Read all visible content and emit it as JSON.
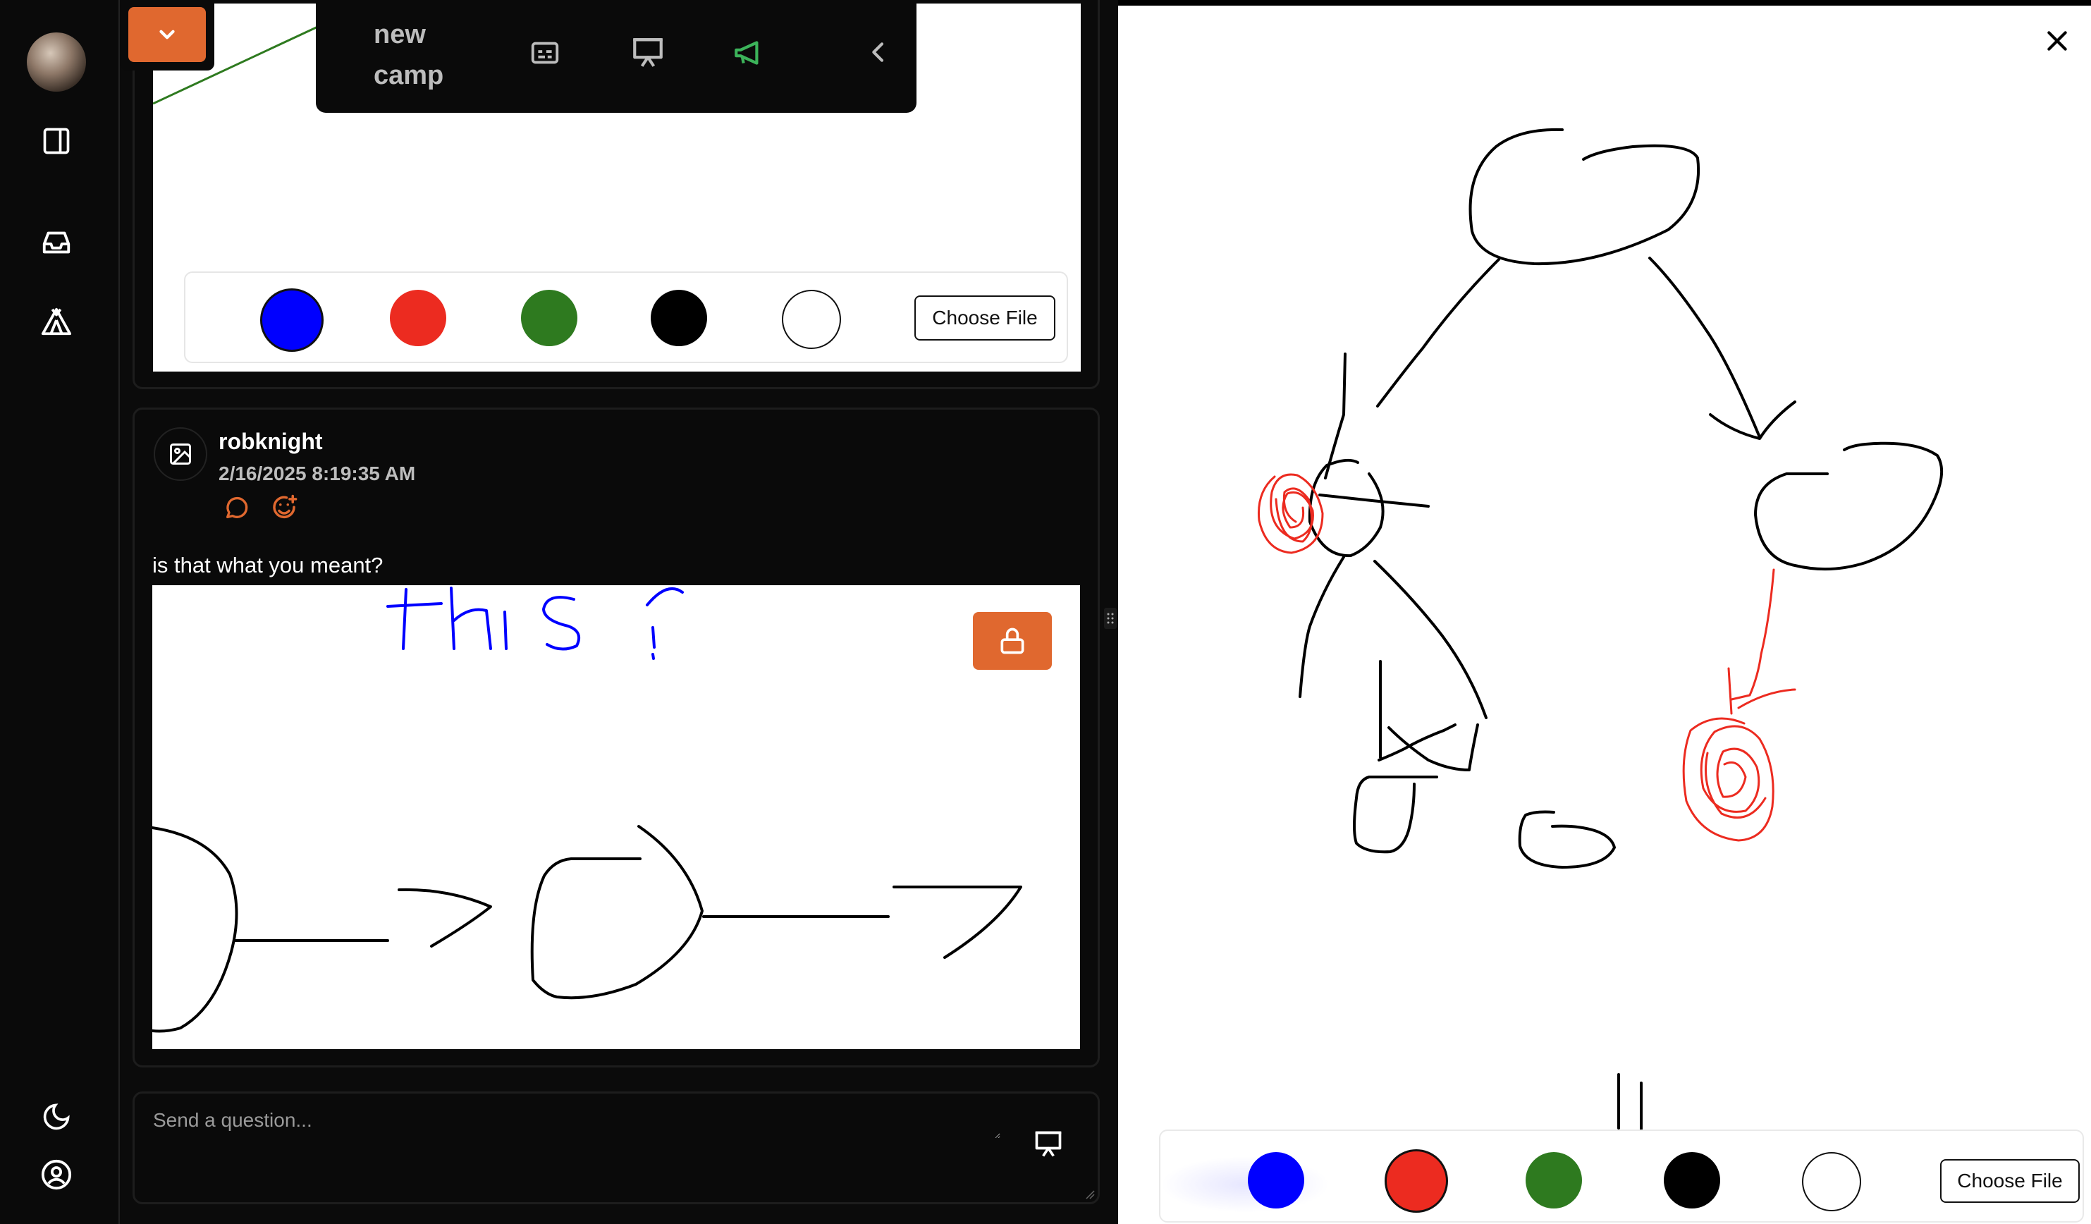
{
  "sidebar": {
    "avatar": "user-avatar",
    "items": [
      {
        "name": "panel-toggle-icon"
      },
      {
        "name": "inbox-icon"
      },
      {
        "name": "camp-tent-icon"
      }
    ],
    "bottom": [
      {
        "name": "moon-icon"
      },
      {
        "name": "user-circle-icon"
      }
    ]
  },
  "topbar": {
    "camp_name": "new camp",
    "icons": [
      "captions-icon",
      "presentation-icon",
      "megaphone-icon",
      "chevron-left-icon"
    ],
    "megaphone_color": "#3cb35a"
  },
  "palette": {
    "colors": [
      "#0000ff",
      "#ec2b20",
      "#2e7a1f",
      "#000000",
      "#ffffff"
    ],
    "choose_file_label": "Choose File"
  },
  "post": {
    "username": "robknight",
    "timestamp": "2/16/2025 8:19:35 AM",
    "text": "is that what you meant?",
    "accent": "#e0682f"
  },
  "question": {
    "placeholder": "Send a question..."
  },
  "right_panel": {
    "choose_file_label": "Choose File"
  }
}
